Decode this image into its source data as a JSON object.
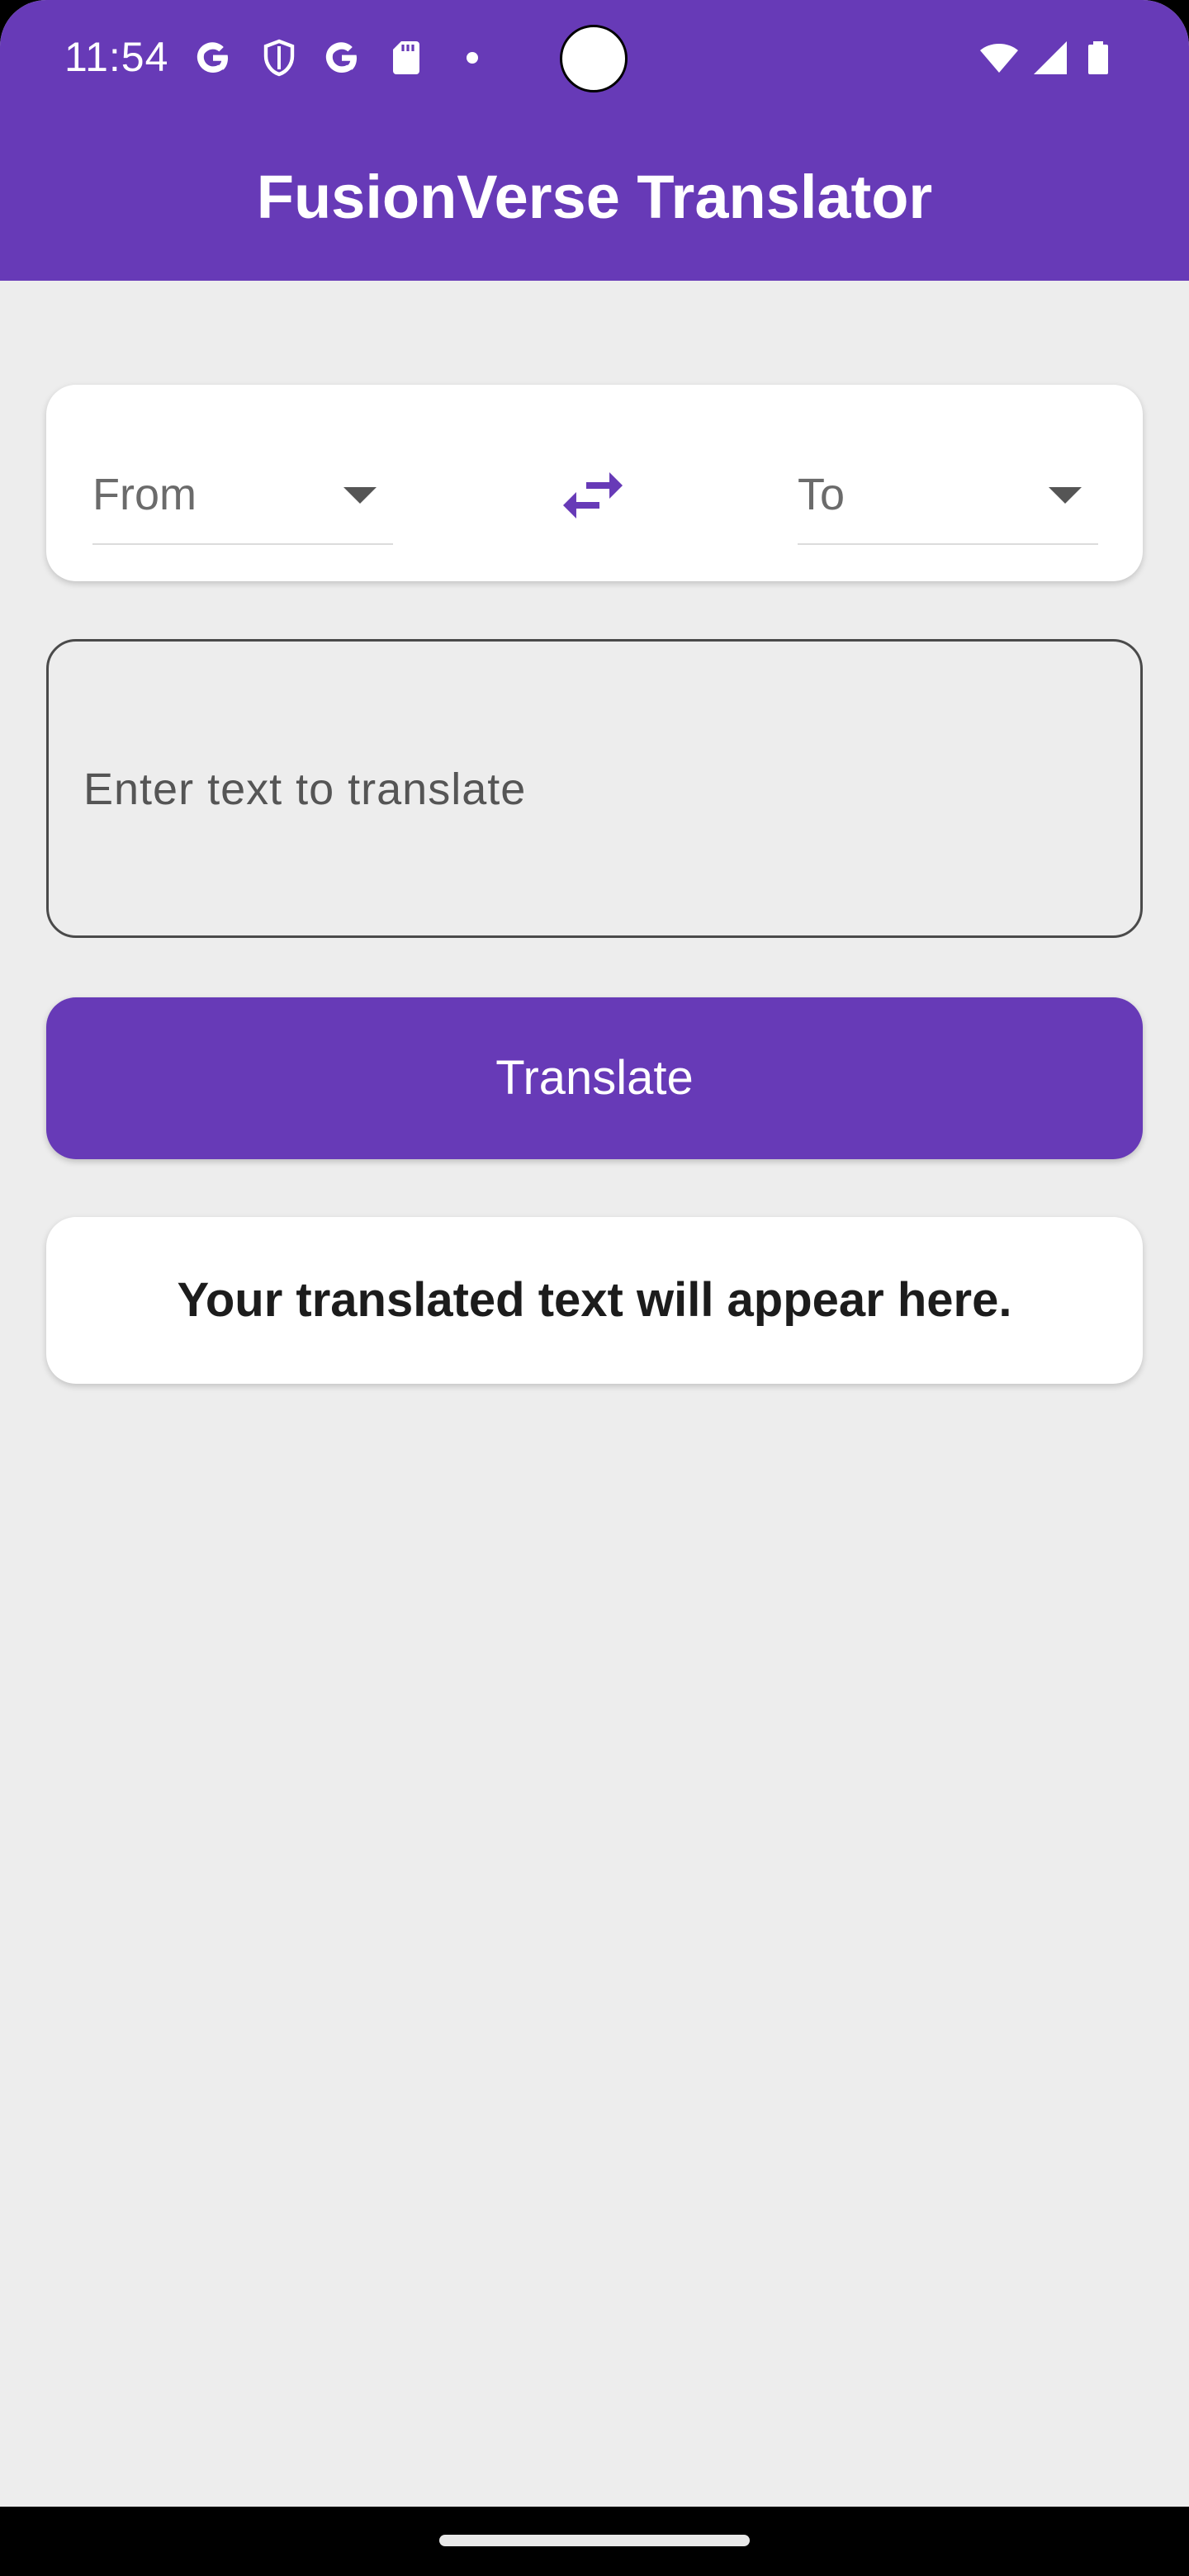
{
  "status_bar": {
    "time": "11:54",
    "icons": [
      "google-g-icon",
      "shield-icon",
      "google-g-icon",
      "sd-card-icon",
      "dot-icon",
      "wifi-icon",
      "signal-icon",
      "battery-icon"
    ]
  },
  "app_bar": {
    "title": "FusionVerse Translator",
    "color": "#673ab7"
  },
  "language_selector": {
    "from_label": "From",
    "to_label": "To",
    "swap_icon": "swap-horiz-icon"
  },
  "input": {
    "placeholder": "Enter text to translate",
    "value": ""
  },
  "translate_button": {
    "label": "Translate"
  },
  "result": {
    "text": "Your translated text will appear here."
  }
}
